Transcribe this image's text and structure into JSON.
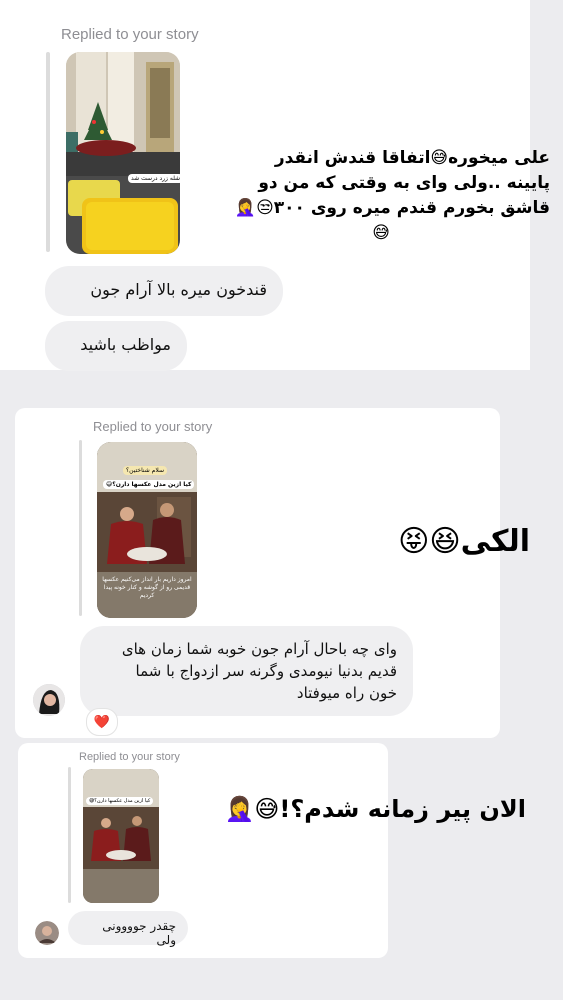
{
  "shot1": {
    "replied_label": "Replied to your story",
    "story_sticker": "شله زرد درست شد",
    "overlay_lines": [
      "علی میخوره😅اتفاقا قندش انقدر",
      "پایینه ..ولی وای به وقتی که من دو",
      "قاشق بخورم قندم میره روی ۳۰۰😒🤦‍♀️",
      "😅"
    ],
    "messages": [
      {
        "text": "قندخون میره بالا آرام جون"
      },
      {
        "text": "مواظب باشید"
      }
    ]
  },
  "shot2": {
    "replied_label": "Replied to your story",
    "story_sticker_top": "سلام شناختین؟",
    "story_sticker_question": "کیا ازین مدل عکسها دارن؟😅",
    "story_caption": "امروز داریم بار انداز می‌کنیم عکسها قدیمی رو از گوشه و کنار خونه پیدا کردیم",
    "overlay_text": "الکی😆😝",
    "message_lines": [
      "وای چه باحال آرام جون خوبه شما زمان های",
      "قدیم بدنیا نیومدی وگرنه سر ازدواج با شما",
      "خون  راه میوفتاد"
    ],
    "reaction": "❤️"
  },
  "shot3": {
    "replied_label": "Replied to your story",
    "story_sticker_question": "کیا ازین مدل عکسها دارن؟😅",
    "overlay_text": "الان پیر زمانه شدم؟!😅🤦‍♀️",
    "message": "چقدر جوووونی ولی"
  },
  "colors": {
    "bubble": "#efeff1",
    "label": "#8e8e93",
    "background": "#ececef",
    "heart": "#e8262f"
  }
}
